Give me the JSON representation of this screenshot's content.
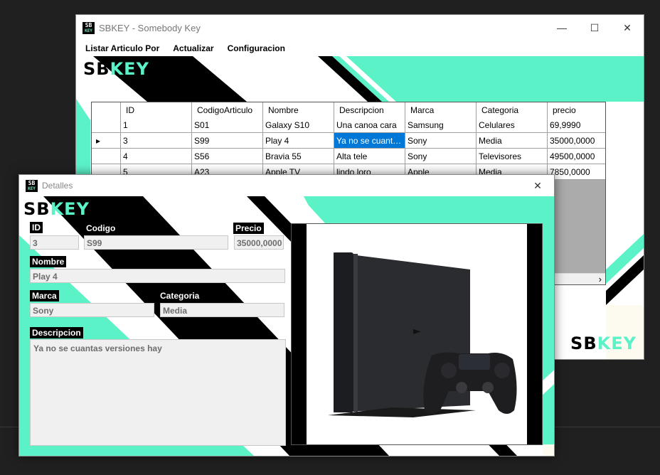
{
  "main_window": {
    "title": "SBKEY - Somebody Key",
    "logo": {
      "part1": "SB",
      "part2": "KEY"
    },
    "menu": [
      "Listar Articulo Por",
      "Actualizar",
      "Configuracion"
    ],
    "grid": {
      "columns": [
        "ID",
        "CodigoArticulo",
        "Nombre",
        "Descripcion",
        "Marca",
        "Categoria",
        "precio"
      ],
      "rows": [
        [
          "1",
          "S01",
          "Galaxy S10",
          "Una canoa cara",
          "Samsung",
          "Celulares",
          "69,9990"
        ],
        [
          "3",
          "S99",
          "Play 4",
          "Ya no se cuantas versiones hay",
          "Sony",
          "Media",
          "35000,0000"
        ],
        [
          "4",
          "S56",
          "Bravia 55",
          "Alta tele",
          "Sony",
          "Televisores",
          "49500,0000"
        ],
        [
          "5",
          "A23",
          "Apple TV",
          "lindo loro",
          "Apple",
          "Media",
          "7850,0000"
        ]
      ],
      "selected_row": 1
    }
  },
  "details_window": {
    "title": "Detalles",
    "logo": {
      "part1": "SB",
      "part2": "KEY"
    },
    "labels": {
      "id": "ID",
      "codigo": "Codigo",
      "precio": "Precio",
      "nombre": "Nombre",
      "marca": "Marca",
      "categoria": "Categoria",
      "descripcion": "Descripcion"
    },
    "values": {
      "id": "3",
      "codigo": "S99",
      "precio": "35000,0000",
      "nombre": "Play 4",
      "marca": "Sony",
      "categoria": "Media",
      "descripcion": "Ya no se cuantas versiones hay"
    }
  },
  "colors": {
    "accent": "#5cf2c8",
    "selection": "#0078d7"
  }
}
